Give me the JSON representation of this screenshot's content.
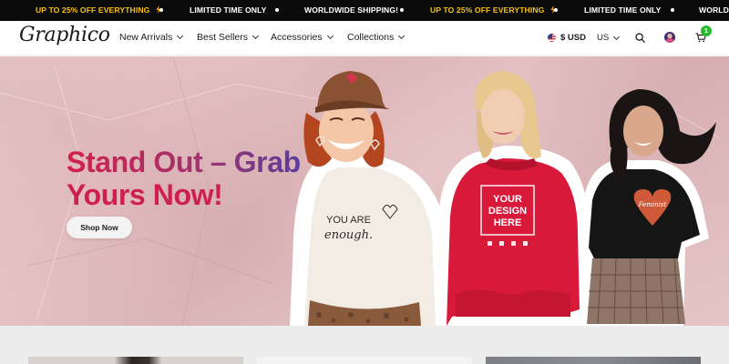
{
  "announcement": {
    "items": [
      {
        "text": "UP TO 25% OFF EVERYTHING",
        "style": "promo",
        "icon": "bolt-icon"
      },
      {
        "text": "LIMITED TIME ONLY",
        "style": "plain"
      },
      {
        "text": "WORLDWIDE SHIPPING!",
        "style": "plain"
      },
      {
        "text": "UP TO 25% OFF EVERYTHING",
        "style": "promo",
        "icon": "bolt-icon"
      },
      {
        "text": "LIMITED TIME ONLY",
        "style": "plain"
      },
      {
        "text": "WORLDWID",
        "style": "plain"
      }
    ]
  },
  "header": {
    "logo": "Graphico",
    "nav": [
      {
        "label": "New Arrivals"
      },
      {
        "label": "Best Sellers"
      },
      {
        "label": "Accessories"
      },
      {
        "label": "Collections"
      }
    ],
    "currency": "$ USD",
    "language": "US",
    "cart_count": "1"
  },
  "hero": {
    "headline_line1": "Stand Out – Grab",
    "headline_line2": "Yours Now!",
    "cta": "Shop Now",
    "shirt_left_line1": "YOU ARE",
    "shirt_left_line2": "enough.",
    "hoodie_line1": "YOUR",
    "hoodie_line2": "DESIGN",
    "hoodie_line3": "HERE",
    "shirt_right": "Feminist"
  },
  "colors": {
    "bar_bg": "#0b0b0b",
    "promo_yellow": "#f7c30e",
    "hero_bg": "#e4bec0",
    "headline_red": "#cf1f4d",
    "headline_purple": "#5a3d9a",
    "badge_green": "#28b92f",
    "hoodie_red": "#d9193a"
  }
}
